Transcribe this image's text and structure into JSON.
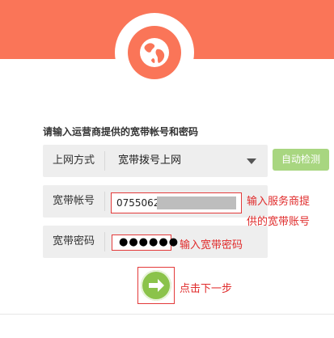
{
  "header": {
    "logo_icon": "globe-icon",
    "brand_color": "#fa7558"
  },
  "instruction": "请输入运营商提供的宽带帐号和密码",
  "connection_type": {
    "label": "上网方式",
    "value": "宽带拨号上网"
  },
  "auto_detect_label": "自动检测",
  "account": {
    "label": "宽带帐号",
    "value_visible": "0755062"
  },
  "password": {
    "label": "宽带密码",
    "value_masked": "●●●●●●"
  },
  "hints": {
    "account_line1": "输入服务商提",
    "account_line2": "供的宽带账号",
    "password": "输入宽带密码",
    "next": "点击下一步"
  },
  "next_button_icon": "arrow-right-icon",
  "colors": {
    "accent_green": "#8bc34a",
    "annotation_red": "#e33a3a"
  }
}
